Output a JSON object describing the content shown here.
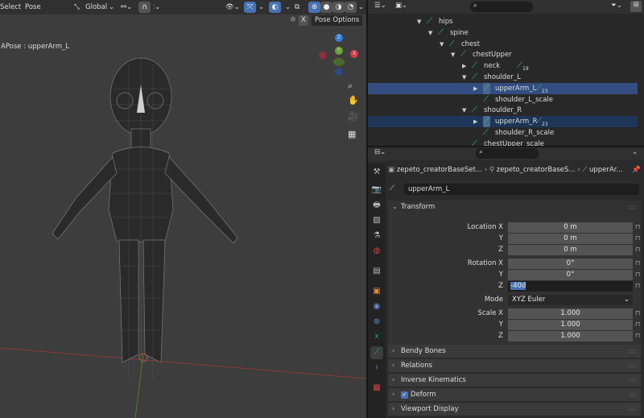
{
  "viewport": {
    "menu": [
      "Select",
      "Pose"
    ],
    "orientation": "Global",
    "pose_options": "Pose Options",
    "x_mirror": "X",
    "object_label": "APose : upperArm_L",
    "gizmo_axes": {
      "z": "Z",
      "y": "Y",
      "x": "X"
    },
    "colors": {
      "z": "#2f7fd8",
      "y": "#6aa232",
      "x": "#d83a4a",
      "accent": "#4772b3"
    }
  },
  "outliner": {
    "rows": [
      {
        "label": "hips",
        "level": 0,
        "expanded": true
      },
      {
        "label": "spine",
        "level": 1,
        "expanded": true
      },
      {
        "label": "chest",
        "level": 2,
        "expanded": true
      },
      {
        "label": "chestUpper",
        "level": 3,
        "expanded": true
      },
      {
        "label": "neck",
        "level": 4,
        "expanded": false,
        "child_count": "19"
      },
      {
        "label": "shoulder_L",
        "level": 4,
        "expanded": true
      },
      {
        "label": "upperArm_L",
        "level": 5,
        "expanded": false,
        "child_count": "23",
        "selected": "active"
      },
      {
        "label": "shoulder_L_scale",
        "level": 5
      },
      {
        "label": "shoulder_R",
        "level": 4,
        "expanded": true
      },
      {
        "label": "upperArm_R",
        "level": 5,
        "expanded": false,
        "child_count": "23",
        "selected": "secondary"
      },
      {
        "label": "shoulder_R_scale",
        "level": 5
      },
      {
        "label": "chestUpper_scale",
        "level": 4
      }
    ]
  },
  "properties": {
    "breadcrumb": [
      "zepeto_creatorBaseSet...",
      "zepeto_creatorBaseS...",
      "upperAr..."
    ],
    "bone_name": "upperArm_L",
    "transform": {
      "title": "Transform",
      "location": {
        "label": "Location X",
        "x": "0 m",
        "y": "0 m",
        "z": "0 m"
      },
      "rotation": {
        "label": "Rotation X",
        "x": "0°",
        "y": "0°",
        "z": "-40d"
      },
      "mode": {
        "label": "Mode",
        "value": "XYZ Euler"
      },
      "scale": {
        "label": "Scale X",
        "x": "1.000",
        "y": "1.000",
        "z": "1.000"
      },
      "axis_y": "Y",
      "axis_z": "Z"
    },
    "panels": [
      "Bendy Bones",
      "Relations",
      "Inverse Kinematics",
      "Deform",
      "Viewport Display"
    ],
    "deform_checked": true
  }
}
